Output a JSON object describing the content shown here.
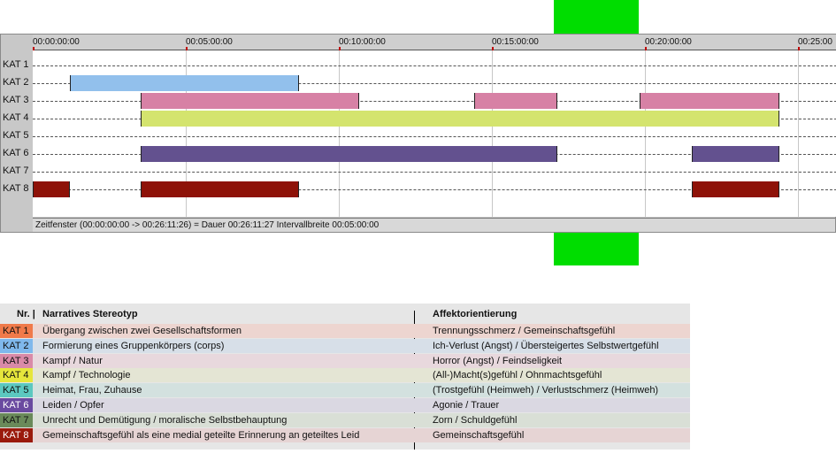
{
  "timeline": {
    "ticks": [
      "00:00:00:00",
      "00:05:00:00",
      "00:10:00:00",
      "00:15:00:00",
      "00:20:00:00",
      "00:25:00"
    ],
    "categories": [
      "KAT 1",
      "KAT 2",
      "KAT 3",
      "KAT 4",
      "KAT 5",
      "KAT 6",
      "KAT 7",
      "KAT 8"
    ],
    "status": "Zeitfenster (00:00:00:00 -> 00:26:11:26) = Dauer 00:26:11:27    Intervallbreite 00:05:00:00",
    "segments": [
      {
        "cat": 2,
        "start": "00:01:12",
        "end": "00:08:42",
        "color": "#92c0ec"
      },
      {
        "cat": 3,
        "start": "00:03:32",
        "end": "00:10:40",
        "color": "#d781a5"
      },
      {
        "cat": 3,
        "start": "00:14:25",
        "end": "00:17:08",
        "color": "#d781a5"
      },
      {
        "cat": 3,
        "start": "00:19:50",
        "end": "00:24:24",
        "color": "#d781a5"
      },
      {
        "cat": 4,
        "start": "00:03:32",
        "end": "00:24:24",
        "color": "#d4e46e"
      },
      {
        "cat": 6,
        "start": "00:03:32",
        "end": "00:17:08",
        "color": "#63518f"
      },
      {
        "cat": 6,
        "start": "00:21:32",
        "end": "00:24:24",
        "color": "#63518f"
      },
      {
        "cat": 8,
        "start": "00:00:00",
        "end": "00:01:12",
        "color": "#8e1208"
      },
      {
        "cat": 8,
        "start": "00:03:32",
        "end": "00:08:42",
        "color": "#8e1208"
      },
      {
        "cat": 8,
        "start": "00:21:32",
        "end": "00:24:24",
        "color": "#8e1208"
      }
    ]
  },
  "legend": {
    "headers": {
      "nr": "Nr. |",
      "narrative": "Narratives Stereotyp",
      "affect": "Affektorientierung"
    },
    "rows": [
      {
        "code": "KAT 1",
        "badge": "#f07a4a",
        "bg": "#edd5d0",
        "narrative": "Übergang zwischen zwei Gesellschaftsformen",
        "affect": "Trennungsschmerz / Gemeinschaftsgefühl"
      },
      {
        "code": "KAT 2",
        "badge": "#7fb8ec",
        "bg": "#d7dfe8",
        "narrative": "Formierung eines Gruppenkörpers (corps)",
        "affect": "Ich-Verlust (Angst) / Übersteigertes Selbstwertgefühl"
      },
      {
        "code": "KAT 3",
        "badge": "#d98aa8",
        "bg": "#e8d8dd",
        "narrative": "Kampf / Natur",
        "affect": "Horror (Angst) / Feindseligkeit"
      },
      {
        "code": "KAT 4",
        "badge": "#e6e63c",
        "bg": "#e4e5d4",
        "narrative": "Kampf / Technologie",
        "affect": "(All-)Macht(s)gefühl / Ohnmachtsgefühl"
      },
      {
        "code": "KAT 5",
        "badge": "#5cc8c0",
        "bg": "#d3e1df",
        "narrative": "Heimat, Frau, Zuhause",
        "affect": "(Trostgefühl (Heimweh) / Verlustschmerz (Heimweh)"
      },
      {
        "code": "KAT 6",
        "badge": "#6a4aa0",
        "bg": "#dad8e2",
        "narrative": "Leiden / Opfer",
        "affect": "Agonie / Trauer"
      },
      {
        "code": "KAT 7",
        "badge": "#6a8a5a",
        "bg": "#d9dfd6",
        "narrative": "Unrecht und Demütigung / moralische Selbstbehauptung",
        "affect": "Zorn / Schuldgefühl"
      },
      {
        "code": "KAT 8",
        "badge": "#9a1a0c",
        "bg": "#e6d4d4",
        "narrative": "Gemeinschaftsgefühl als eine medial geteilte Erinnerung an geteiltes Leid",
        "affect": "Gemeinschaftsgefühl"
      }
    ]
  }
}
